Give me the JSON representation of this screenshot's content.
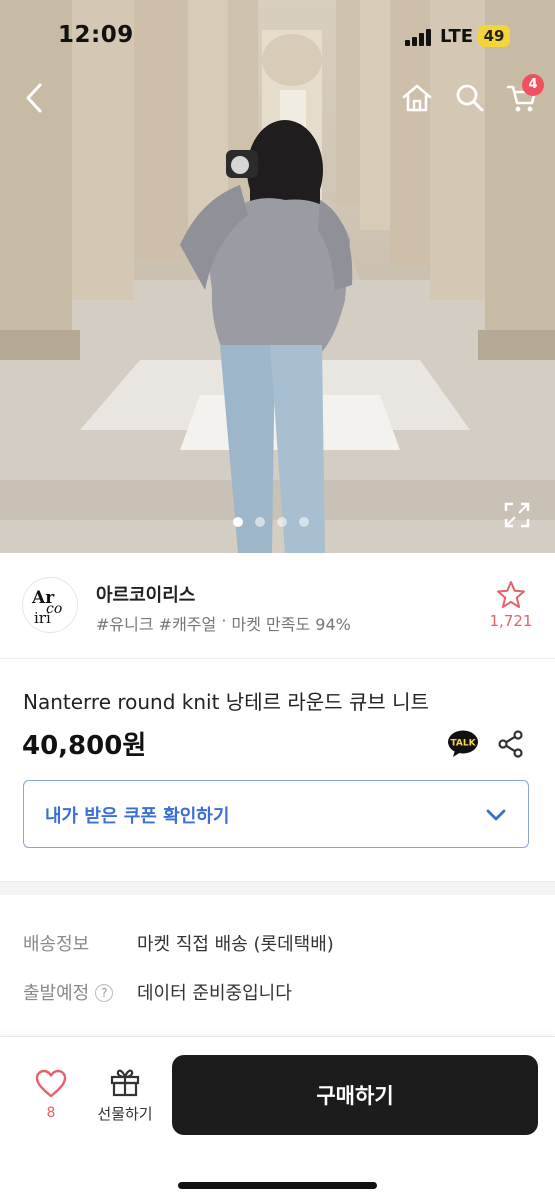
{
  "status_bar": {
    "time": "12:09",
    "network": "LTE",
    "battery": "49"
  },
  "header": {
    "back_icon": "chevron-left-icon",
    "home_icon": "home-icon",
    "search_icon": "search-icon",
    "cart_icon": "cart-icon",
    "cart_count": "4"
  },
  "gallery": {
    "image_count": 4,
    "active_index": 0,
    "expand_icon": "expand-icon"
  },
  "seller": {
    "name": "아르코이리스",
    "tag1": "#유니크",
    "tag2": " #캐주얼",
    "tag_separator": " · ",
    "satisfaction": "마켓 만족도 94%",
    "favorite_count": "1,721",
    "logo_text": "Arcoiris"
  },
  "product": {
    "title": "Nanterre round knit 낭테르 라운드 큐브 니트",
    "price": "40,800원",
    "talk_label": "TALK",
    "coupon_label": "내가 받은 쿠폰 확인하기"
  },
  "info": {
    "shipping_label": "배송정보",
    "shipping_value": "마켓 직접 배송 (롯데택배)",
    "departure_label": "출발예정",
    "departure_help": "?",
    "departure_value": "데이터 준비중입니다"
  },
  "bottom_bar": {
    "like_count": "8",
    "gift_label": "선물하기",
    "buy_label": "구매하기"
  },
  "colors": {
    "accent_pink": "#e8606c",
    "coupon_blue": "#3b6fd6",
    "buy_button": "#1c1c1c",
    "badge_red": "#f1505f"
  }
}
